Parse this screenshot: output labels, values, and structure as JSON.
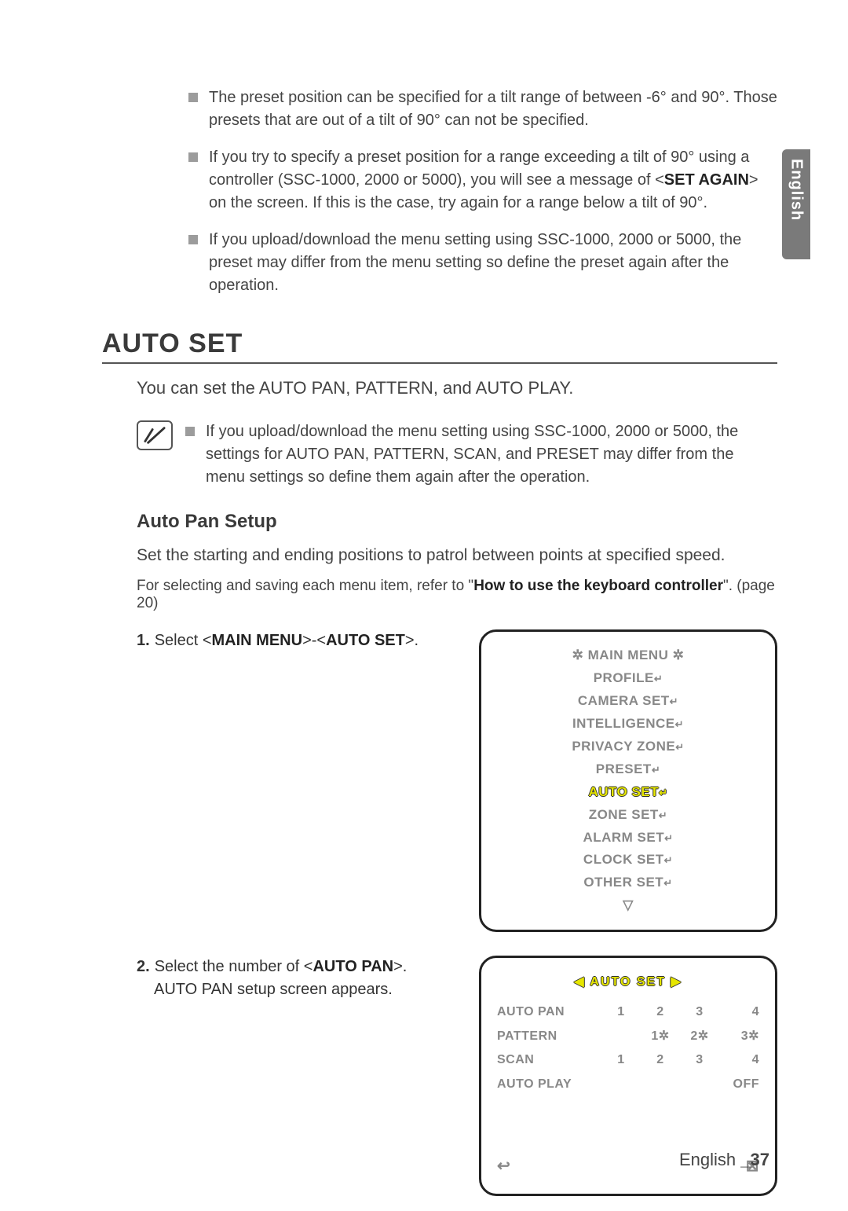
{
  "side_tab": "English",
  "top_bullets": [
    "The preset position can be specified for a tilt range of between -6° and 90°. Those presets that are out of a tilt of 90° can not be specified.",
    "If you try to specify a preset position for a range exceeding a tilt of 90° using a controller (SSC-1000, 2000 or 5000), you will see a message of <__B__SET AGAIN__/B__> on the screen. If this is the case, try again for a range below a tilt of 90°.",
    "If you upload/download the menu setting using SSC-1000, 2000 or 5000, the preset may differ from the menu setting so define the preset again after the operation."
  ],
  "section_title": "AUTO SET",
  "intro": "You can set the AUTO PAN, PATTERN, and AUTO PLAY.",
  "note": "If you upload/download the menu setting using SSC-1000, 2000 or 5000, the settings for AUTO PAN, PATTERN, SCAN, and PRESET may differ from the menu settings so define them again after the operation.",
  "sub_heading": "Auto Pan Setup",
  "sub_body": "Set the starting and ending positions to patrol between points at specified speed.",
  "ref_line_pre": "For selecting and saving each menu item, refer to \"",
  "ref_line_bold": "How to use the keyboard controller",
  "ref_line_post": "\". (page 20)",
  "step1_num": "1.",
  "step1_text": "Select <__B__MAIN MENU__/B__>-<__B__AUTO SET__/B__>.",
  "step2_num": "2.",
  "step2_text_a": "Select the number of <__B__AUTO PAN__/B__>.",
  "step2_text_b": "AUTO PAN setup screen appears.",
  "osd1": {
    "title": "✲ MAIN MENU ✲",
    "items": [
      "PROFILE",
      "CAMERA SET",
      "INTELLIGENCE",
      "PRIVACY ZONE",
      "PRESET"
    ],
    "highlight": "AUTO SET",
    "items_after": [
      "ZONE SET",
      "ALARM SET",
      "CLOCK SET",
      "OTHER SET"
    ],
    "tail": "▽"
  },
  "osd2": {
    "title": "◀  AUTO SET  ▶",
    "rows": [
      {
        "label": "AUTO PAN",
        "vals": [
          "1",
          "2",
          "3",
          "4"
        ]
      },
      {
        "label": "PATTERN",
        "vals": [
          "",
          "1✲",
          "2✲",
          "3✲"
        ]
      },
      {
        "label": "SCAN",
        "vals": [
          "1",
          "2",
          "3",
          "4"
        ]
      },
      {
        "label": "AUTO PLAY",
        "vals": [
          "",
          "",
          "",
          "OFF"
        ]
      }
    ],
    "back": "↩",
    "close": "⊠"
  },
  "footer_lang": "English",
  "footer_page": "_37"
}
